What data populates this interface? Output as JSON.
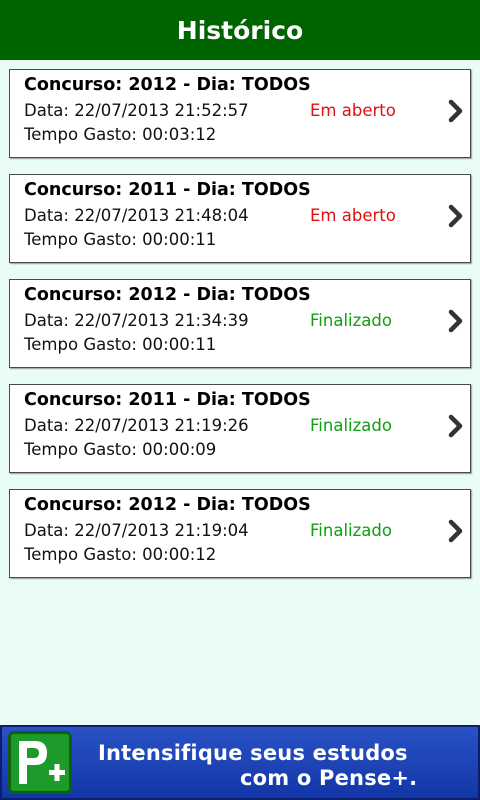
{
  "header": {
    "title": "Histórico"
  },
  "history": [
    {
      "title": "Concurso: 2012 - Dia: TODOS",
      "date": "Data: 22/07/2013 21:52:57",
      "time": "Tempo Gasto: 00:03:12",
      "status": "Em aberto",
      "status_color": "#e01010"
    },
    {
      "title": "Concurso: 2011 - Dia: TODOS",
      "date": "Data: 22/07/2013 21:48:04",
      "time": "Tempo Gasto: 00:00:11",
      "status": "Em aberto",
      "status_color": "#e01010"
    },
    {
      "title": "Concurso: 2012 - Dia: TODOS",
      "date": "Data: 22/07/2013 21:34:39",
      "time": "Tempo Gasto: 00:00:11",
      "status": "Finalizado",
      "status_color": "#10a010"
    },
    {
      "title": "Concurso: 2011 - Dia: TODOS",
      "date": "Data: 22/07/2013 21:19:26",
      "time": "Tempo Gasto: 00:00:09",
      "status": "Finalizado",
      "status_color": "#10a010"
    },
    {
      "title": "Concurso: 2012 - Dia: TODOS",
      "date": "Data: 22/07/2013 21:19:04",
      "time": "Tempo Gasto: 00:00:12",
      "status": "Finalizado",
      "status_color": "#10a010"
    }
  ],
  "banner": {
    "line1": "Intensifique seus estudos",
    "line2": "com o Pense+.",
    "logo": "pense-plus-logo"
  },
  "colors": {
    "header_bg": "#006400",
    "page_bg": "#e9fdf4",
    "status_open": "#e01010",
    "status_done": "#10a010",
    "banner_bg": "#1f45b8"
  }
}
